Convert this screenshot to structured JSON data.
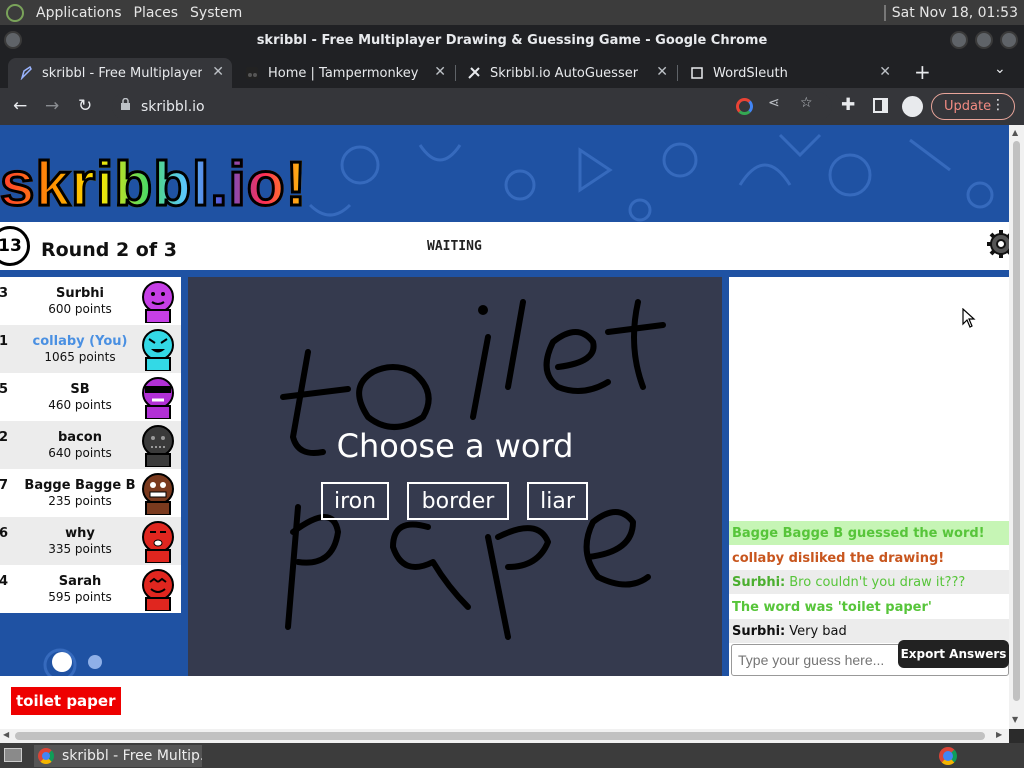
{
  "system_bar": {
    "menus": [
      "Applications",
      "Places",
      "System"
    ],
    "datetime": "Sat Nov 18, 01:53"
  },
  "window": {
    "title": "skribbl - Free Multiplayer Drawing & Guessing Game - Google Chrome"
  },
  "tabs": [
    {
      "label": "skribbl - Free Multiplayer Dr",
      "icon": "pencil-icon",
      "active": true
    },
    {
      "label": "Home | Tampermonkey",
      "icon": "tampermonkey-icon",
      "active": false
    },
    {
      "label": "Skribbl.io AutoGuesser",
      "icon": "script-icon",
      "active": false
    },
    {
      "label": "WordSleuth",
      "icon": "wordsleuth-icon",
      "active": false
    }
  ],
  "toolbar": {
    "url": "skribbl.io",
    "update_label": "Update"
  },
  "game": {
    "logo": "skribbl.io!",
    "timer": "13",
    "round": "Round 2 of 3",
    "status": "WAITING",
    "players": [
      {
        "rank": "3",
        "name": "Surbhi",
        "points": "600 points",
        "color": "#c63fe6",
        "you": false
      },
      {
        "rank": "1",
        "name": "collaby (You)",
        "points": "1065 points",
        "color": "#33d9e6",
        "you": true
      },
      {
        "rank": "5",
        "name": "SB",
        "points": "460 points",
        "color": "#b230d6",
        "you": false
      },
      {
        "rank": "2",
        "name": "bacon",
        "points": "640 points",
        "color": "#3a3a3a",
        "you": false
      },
      {
        "rank": "7",
        "name": "Bagge Bagge B",
        "points": "235 points",
        "color": "#7a3a1e",
        "you": false
      },
      {
        "rank": "6",
        "name": "why",
        "points": "335 points",
        "color": "#e0261f",
        "you": false
      },
      {
        "rank": "4",
        "name": "Sarah",
        "points": "595 points",
        "color": "#e0261f",
        "you": false
      }
    ],
    "choose_prompt": "Choose a word",
    "word_choices": [
      "iron",
      "border",
      "liar"
    ],
    "chat": [
      {
        "text": "Bagge Bagge B guessed the word!",
        "color": "#57c53a",
        "bg": "#c6f5b5",
        "name": ""
      },
      {
        "text": "collaby disliked the drawing!",
        "color": "#c8561e",
        "bg": "#ffffff",
        "name": ""
      },
      {
        "text": "Bro couldn't you draw it???",
        "color": "#57c53a",
        "bg": "#ececec",
        "name": "Surbhi:"
      },
      {
        "text": "The word was 'toilet paper'",
        "color": "#57c53a",
        "bg": "#ffffff",
        "name": ""
      },
      {
        "text": "Very bad",
        "color": "#111111",
        "bg": "#ececec",
        "name": "Surbhi:"
      }
    ],
    "guess_placeholder": "Type your guess here...",
    "export_label": "Export Answers",
    "answer_badge": "toilet paper"
  },
  "taskbar": {
    "item": "skribbl - Free Multip..."
  }
}
